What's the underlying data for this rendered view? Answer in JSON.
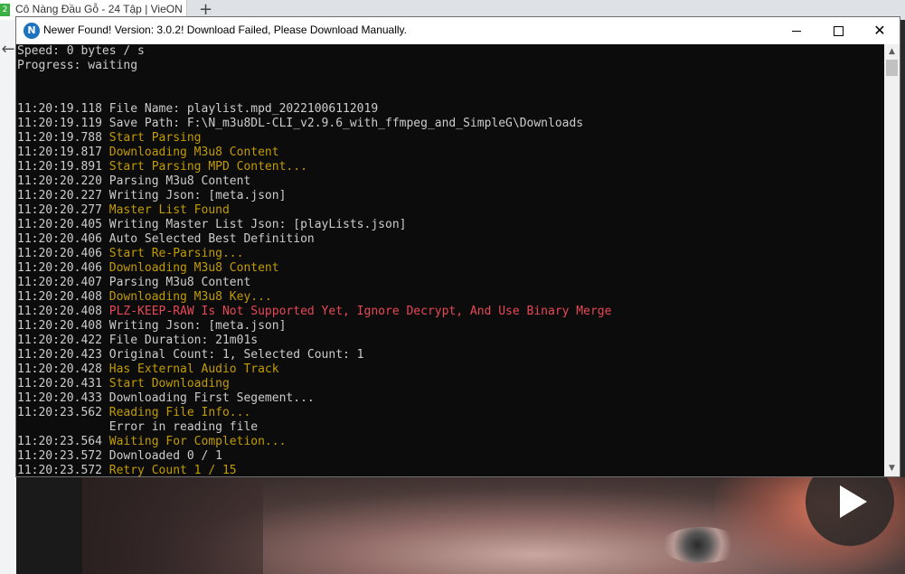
{
  "background": {
    "tab_title": "Cô Nàng Đầu Gỗ - 24 Tập | VieON",
    "favicon_text": "2",
    "new_tab_label": "+",
    "back_arrow": "←"
  },
  "window": {
    "app_icon_letter": "N",
    "title": "Newer Found! Version: 3.0.2! Download Failed, Please Download Manually.",
    "controls": [
      "minimize",
      "maximize",
      "close"
    ],
    "close_glyph": "✕"
  },
  "colors": {
    "console_bg": "#0c0c0c",
    "text_default": "#cccccc",
    "text_yellow": "#c19c00",
    "text_red": "#e74856"
  },
  "console": {
    "lines": [
      {
        "ts": "",
        "msg": "Speed: 0 bytes / s",
        "color": "white"
      },
      {
        "ts": "",
        "msg": "Progress: waiting",
        "color": "white"
      },
      {
        "ts": "",
        "msg": "",
        "color": "white"
      },
      {
        "ts": "",
        "msg": "",
        "color": "white"
      },
      {
        "ts": "11:20:19.118",
        "msg": "File Name: playlist.mpd_20221006112019",
        "color": "white"
      },
      {
        "ts": "11:20:19.119",
        "msg": "Save Path: F:\\N_m3u8DL-CLI_v2.9.6_with_ffmpeg_and_SimpleG\\Downloads",
        "color": "white"
      },
      {
        "ts": "11:20:19.788",
        "msg": "Start Parsing",
        "color": "yellow"
      },
      {
        "ts": "11:20:19.817",
        "msg": "Downloading M3u8 Content",
        "color": "yellow"
      },
      {
        "ts": "11:20:19.891",
        "msg": "Start Parsing MPD Content...",
        "color": "yellow"
      },
      {
        "ts": "11:20:20.220",
        "msg": "Parsing M3u8 Content",
        "color": "white"
      },
      {
        "ts": "11:20:20.227",
        "msg": "Writing Json: [meta.json]",
        "color": "white"
      },
      {
        "ts": "11:20:20.277",
        "msg": "Master List Found",
        "color": "yellow"
      },
      {
        "ts": "11:20:20.405",
        "msg": "Writing Master List Json: [playLists.json]",
        "color": "white"
      },
      {
        "ts": "11:20:20.406",
        "msg": "Auto Selected Best Definition",
        "color": "white"
      },
      {
        "ts": "11:20:20.406",
        "msg": "Start Re-Parsing...",
        "color": "yellow"
      },
      {
        "ts": "11:20:20.406",
        "msg": "Downloading M3u8 Content",
        "color": "yellow"
      },
      {
        "ts": "11:20:20.407",
        "msg": "Parsing M3u8 Content",
        "color": "white"
      },
      {
        "ts": "11:20:20.408",
        "msg": "Downloading M3u8 Key...",
        "color": "yellow"
      },
      {
        "ts": "11:20:20.408",
        "msg": "PLZ-KEEP-RAW Is Not Supported Yet, Ignore Decrypt, And Use Binary Merge",
        "color": "red"
      },
      {
        "ts": "11:20:20.408",
        "msg": "Writing Json: [meta.json]",
        "color": "white"
      },
      {
        "ts": "11:20:20.422",
        "msg": "File Duration: 21m01s",
        "color": "white"
      },
      {
        "ts": "11:20:20.423",
        "msg": "Original Count: 1, Selected Count: 1",
        "color": "white"
      },
      {
        "ts": "11:20:20.428",
        "msg": "Has External Audio Track",
        "color": "yellow"
      },
      {
        "ts": "11:20:20.431",
        "msg": "Start Downloading",
        "color": "yellow"
      },
      {
        "ts": "11:20:20.433",
        "msg": "Downloading First Segement...",
        "color": "white"
      },
      {
        "ts": "11:20:23.562",
        "msg": "Reading File Info...",
        "color": "yellow"
      },
      {
        "ts": "",
        "msg": "             Error in reading file",
        "color": "white"
      },
      {
        "ts": "11:20:23.564",
        "msg": "Waiting For Completion...",
        "color": "yellow"
      },
      {
        "ts": "11:20:23.572",
        "msg": "Downloaded 0 / 1",
        "color": "white"
      },
      {
        "ts": "11:20:23.572",
        "msg": "Retry Count 1 / 15",
        "color": "yellow"
      }
    ]
  },
  "scrollbar": {
    "up_arrow": "▲",
    "down_arrow": "▼"
  }
}
